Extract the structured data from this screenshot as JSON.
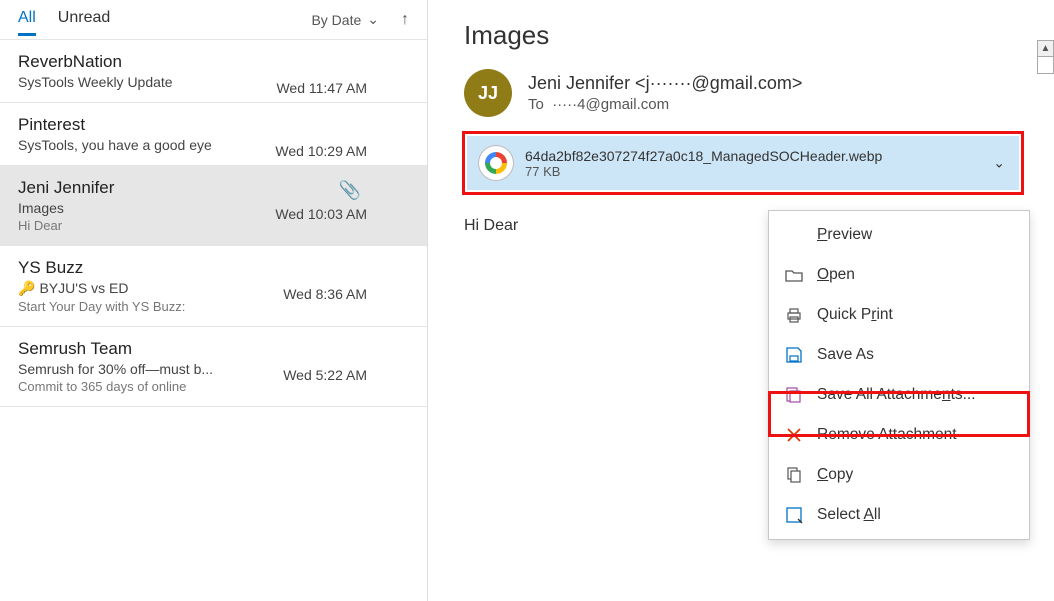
{
  "tabs": {
    "all": "All",
    "unread": "Unread",
    "sort": "By Date"
  },
  "messages": [
    {
      "sender": "ReverbNation",
      "subject": "SysTools Weekly Update",
      "time": "Wed 11:47 AM"
    },
    {
      "sender": "Pinterest",
      "subject": "SysTools, you have a good eye",
      "time": "Wed 10:29 AM"
    },
    {
      "sender": "Jeni Jennifer",
      "subject": "Images",
      "time": "Wed 10:03 AM",
      "preview": "Hi Dear <end>",
      "attachment": true,
      "selected": true
    },
    {
      "sender": "YS Buzz",
      "subject": "BYJU'S vs ED",
      "time": "Wed 8:36 AM",
      "preview": "Start Your Day with YS Buzz:",
      "key": true
    },
    {
      "sender": "Semrush Team",
      "subject": "Semrush for 30% off—must b...",
      "time": "Wed 5:22 AM",
      "preview": "Commit to 365 days of online"
    }
  ],
  "reading": {
    "subject": "Images",
    "avatar": "JJ",
    "from": "Jeni Jennifer <j·······@gmail.com>",
    "to_label": "To",
    "to": "·····4@gmail.com",
    "attachment": {
      "name": "64da2bf82e307274f27a0c18_ManagedSOCHeader.webp",
      "size": "77 KB"
    },
    "body": "Hi Dear"
  },
  "menu": {
    "preview": "Preview",
    "open": "Open",
    "quickprint": "Quick Print",
    "saveas": "Save As",
    "saveall": "Save All Attachments...",
    "remove": "Remove Attachment",
    "copy": "Copy",
    "selectall": "Select All"
  }
}
